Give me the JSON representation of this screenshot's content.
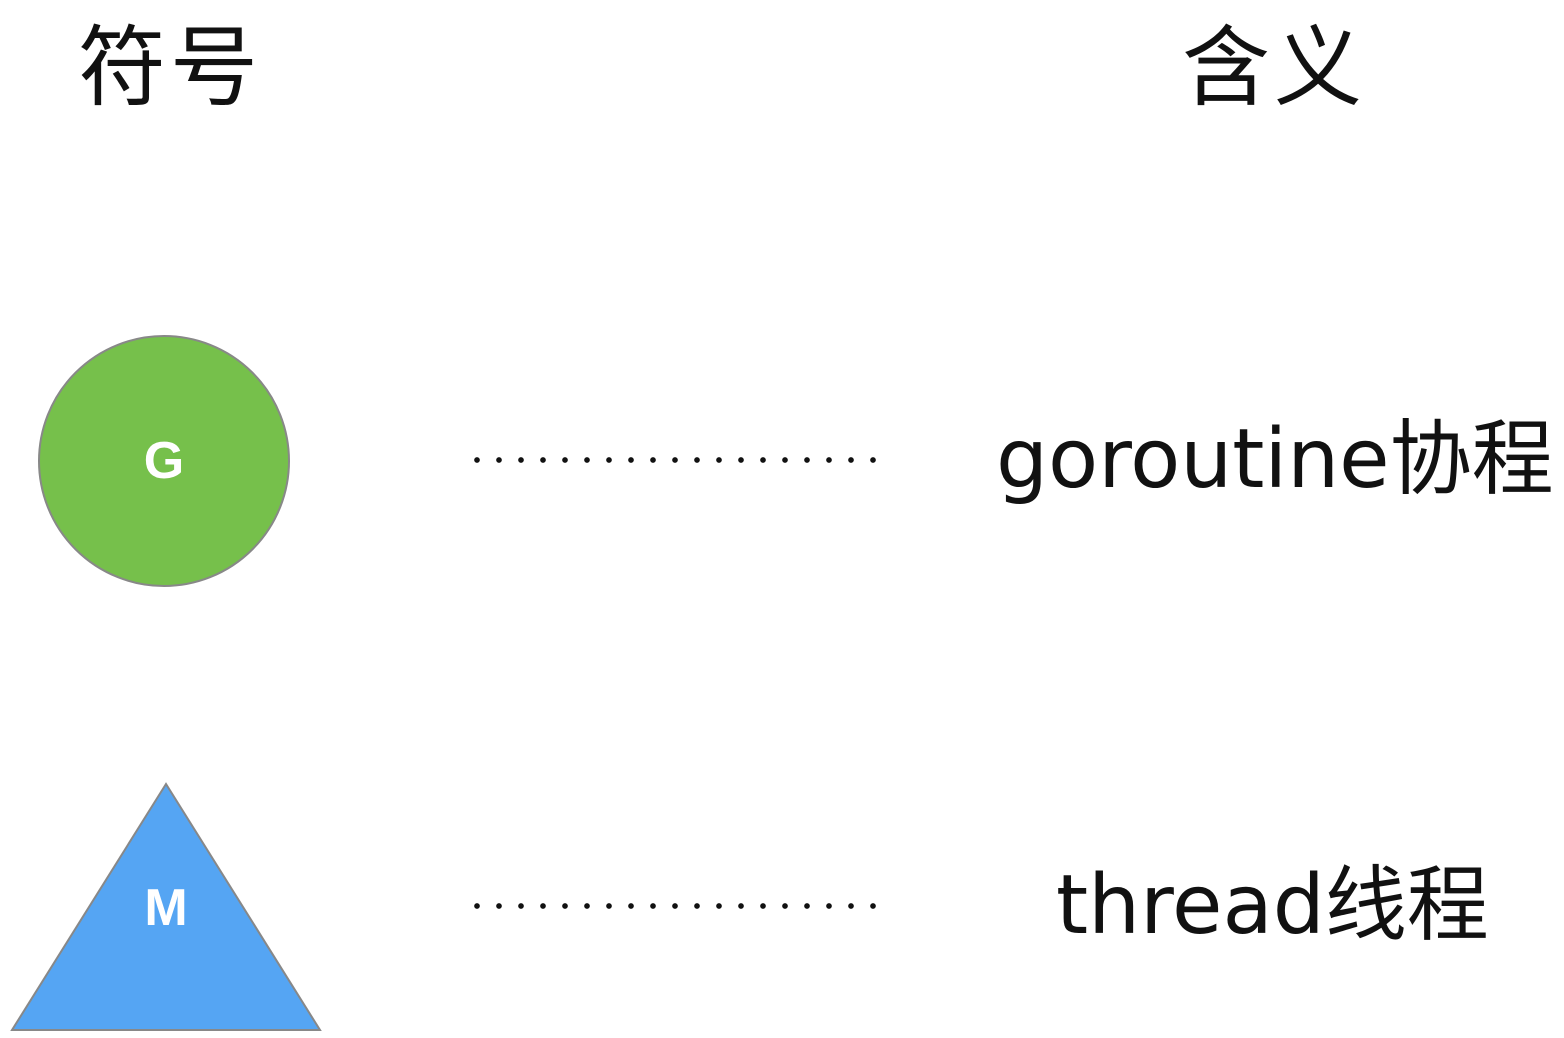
{
  "headers": {
    "symbol": "符号",
    "meaning": "含义"
  },
  "rows": [
    {
      "shape": "circle",
      "letter": "G",
      "fill": "#76c04b",
      "meaning": "goroutine协程"
    },
    {
      "shape": "triangle",
      "letter": "M",
      "fill": "#55a5f3",
      "meaning": "thread线程"
    }
  ],
  "colors": {
    "stroke": "#888888",
    "text": "#111111",
    "background": "#ffffff"
  }
}
